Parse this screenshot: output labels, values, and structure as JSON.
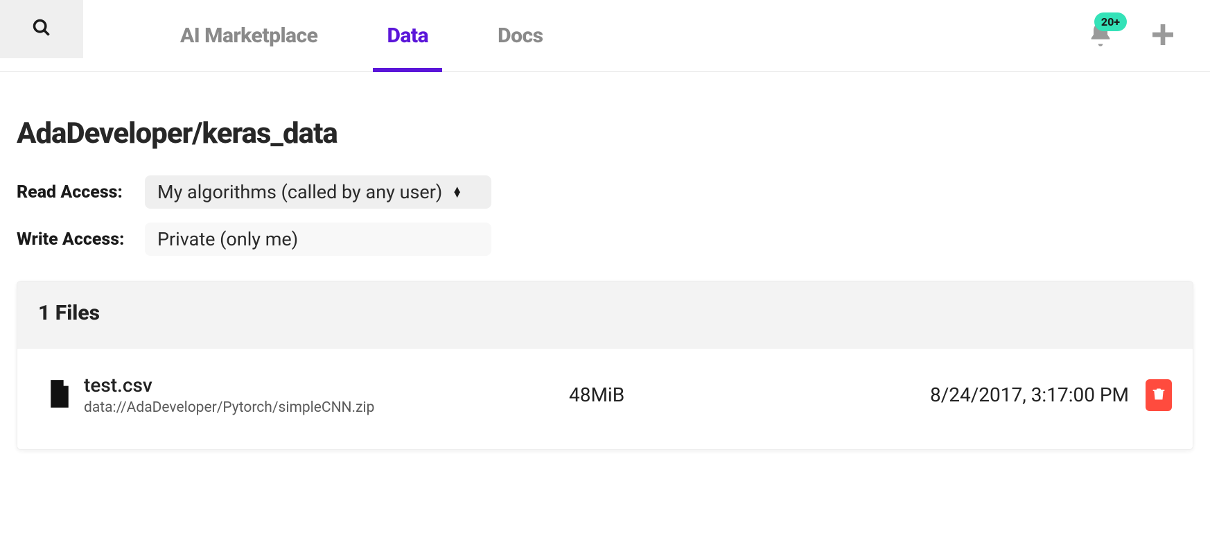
{
  "nav": {
    "tabs": [
      {
        "label": "AI Marketplace",
        "active": false
      },
      {
        "label": "Data",
        "active": true
      },
      {
        "label": "Docs",
        "active": false
      }
    ],
    "notification_badge": "20+"
  },
  "page": {
    "title": "AdaDeveloper/keras_data",
    "read_access_label": "Read Access:",
    "read_access_value": "My algorithms (called by any user)",
    "write_access_label": "Write Access:",
    "write_access_value": "Private (only me)"
  },
  "files": {
    "header": "1 Files",
    "items": [
      {
        "name": "test.csv",
        "path": "data://AdaDeveloper/Pytorch/simpleCNN.zip",
        "size": "48MiB",
        "date": "8/24/2017, 3:17:00 PM"
      }
    ]
  }
}
